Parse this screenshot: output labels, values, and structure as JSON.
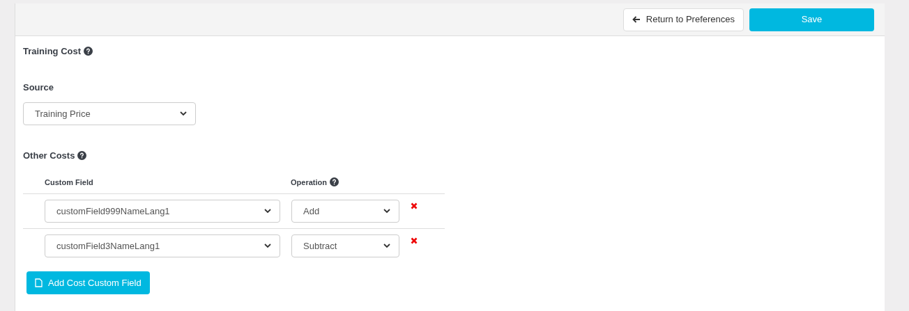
{
  "header": {
    "return_button": "Return to Preferences",
    "save_button": "Save"
  },
  "section_title": "Training Cost",
  "source": {
    "label": "Source",
    "value": "Training Price"
  },
  "other_costs": {
    "label": "Other Costs",
    "columns": [
      "Custom Field",
      "Operation"
    ],
    "rows": [
      {
        "custom_field": "customField999NameLang1",
        "operation": "Add"
      },
      {
        "custom_field": "customField3NameLang1",
        "operation": "Subtract"
      }
    ],
    "add_button": "Add Cost Custom Field"
  }
}
